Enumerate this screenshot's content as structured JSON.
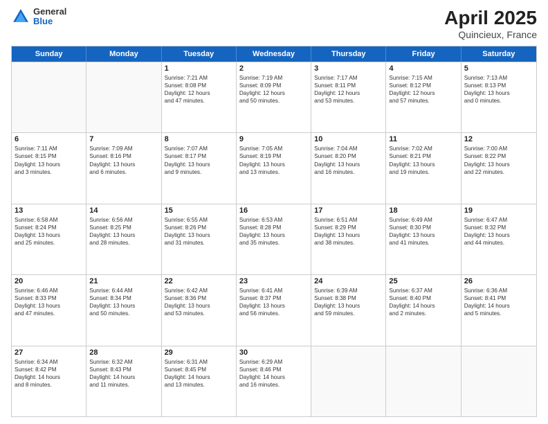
{
  "header": {
    "logo_general": "General",
    "logo_blue": "Blue",
    "month_year": "April 2025",
    "location": "Quincieux, France"
  },
  "calendar": {
    "weekdays": [
      "Sunday",
      "Monday",
      "Tuesday",
      "Wednesday",
      "Thursday",
      "Friday",
      "Saturday"
    ],
    "rows": [
      [
        {
          "day": "",
          "lines": [],
          "empty": true
        },
        {
          "day": "",
          "lines": [],
          "empty": true
        },
        {
          "day": "1",
          "lines": [
            "Sunrise: 7:21 AM",
            "Sunset: 8:08 PM",
            "Daylight: 12 hours",
            "and 47 minutes."
          ],
          "empty": false
        },
        {
          "day": "2",
          "lines": [
            "Sunrise: 7:19 AM",
            "Sunset: 8:09 PM",
            "Daylight: 12 hours",
            "and 50 minutes."
          ],
          "empty": false
        },
        {
          "day": "3",
          "lines": [
            "Sunrise: 7:17 AM",
            "Sunset: 8:11 PM",
            "Daylight: 12 hours",
            "and 53 minutes."
          ],
          "empty": false
        },
        {
          "day": "4",
          "lines": [
            "Sunrise: 7:15 AM",
            "Sunset: 8:12 PM",
            "Daylight: 12 hours",
            "and 57 minutes."
          ],
          "empty": false
        },
        {
          "day": "5",
          "lines": [
            "Sunrise: 7:13 AM",
            "Sunset: 8:13 PM",
            "Daylight: 13 hours",
            "and 0 minutes."
          ],
          "empty": false
        }
      ],
      [
        {
          "day": "6",
          "lines": [
            "Sunrise: 7:11 AM",
            "Sunset: 8:15 PM",
            "Daylight: 13 hours",
            "and 3 minutes."
          ],
          "empty": false
        },
        {
          "day": "7",
          "lines": [
            "Sunrise: 7:09 AM",
            "Sunset: 8:16 PM",
            "Daylight: 13 hours",
            "and 6 minutes."
          ],
          "empty": false
        },
        {
          "day": "8",
          "lines": [
            "Sunrise: 7:07 AM",
            "Sunset: 8:17 PM",
            "Daylight: 13 hours",
            "and 9 minutes."
          ],
          "empty": false
        },
        {
          "day": "9",
          "lines": [
            "Sunrise: 7:05 AM",
            "Sunset: 8:19 PM",
            "Daylight: 13 hours",
            "and 13 minutes."
          ],
          "empty": false
        },
        {
          "day": "10",
          "lines": [
            "Sunrise: 7:04 AM",
            "Sunset: 8:20 PM",
            "Daylight: 13 hours",
            "and 16 minutes."
          ],
          "empty": false
        },
        {
          "day": "11",
          "lines": [
            "Sunrise: 7:02 AM",
            "Sunset: 8:21 PM",
            "Daylight: 13 hours",
            "and 19 minutes."
          ],
          "empty": false
        },
        {
          "day": "12",
          "lines": [
            "Sunrise: 7:00 AM",
            "Sunset: 8:22 PM",
            "Daylight: 13 hours",
            "and 22 minutes."
          ],
          "empty": false
        }
      ],
      [
        {
          "day": "13",
          "lines": [
            "Sunrise: 6:58 AM",
            "Sunset: 8:24 PM",
            "Daylight: 13 hours",
            "and 25 minutes."
          ],
          "empty": false
        },
        {
          "day": "14",
          "lines": [
            "Sunrise: 6:56 AM",
            "Sunset: 8:25 PM",
            "Daylight: 13 hours",
            "and 28 minutes."
          ],
          "empty": false
        },
        {
          "day": "15",
          "lines": [
            "Sunrise: 6:55 AM",
            "Sunset: 8:26 PM",
            "Daylight: 13 hours",
            "and 31 minutes."
          ],
          "empty": false
        },
        {
          "day": "16",
          "lines": [
            "Sunrise: 6:53 AM",
            "Sunset: 8:28 PM",
            "Daylight: 13 hours",
            "and 35 minutes."
          ],
          "empty": false
        },
        {
          "day": "17",
          "lines": [
            "Sunrise: 6:51 AM",
            "Sunset: 8:29 PM",
            "Daylight: 13 hours",
            "and 38 minutes."
          ],
          "empty": false
        },
        {
          "day": "18",
          "lines": [
            "Sunrise: 6:49 AM",
            "Sunset: 8:30 PM",
            "Daylight: 13 hours",
            "and 41 minutes."
          ],
          "empty": false
        },
        {
          "day": "19",
          "lines": [
            "Sunrise: 6:47 AM",
            "Sunset: 8:32 PM",
            "Daylight: 13 hours",
            "and 44 minutes."
          ],
          "empty": false
        }
      ],
      [
        {
          "day": "20",
          "lines": [
            "Sunrise: 6:46 AM",
            "Sunset: 8:33 PM",
            "Daylight: 13 hours",
            "and 47 minutes."
          ],
          "empty": false
        },
        {
          "day": "21",
          "lines": [
            "Sunrise: 6:44 AM",
            "Sunset: 8:34 PM",
            "Daylight: 13 hours",
            "and 50 minutes."
          ],
          "empty": false
        },
        {
          "day": "22",
          "lines": [
            "Sunrise: 6:42 AM",
            "Sunset: 8:36 PM",
            "Daylight: 13 hours",
            "and 53 minutes."
          ],
          "empty": false
        },
        {
          "day": "23",
          "lines": [
            "Sunrise: 6:41 AM",
            "Sunset: 8:37 PM",
            "Daylight: 13 hours",
            "and 56 minutes."
          ],
          "empty": false
        },
        {
          "day": "24",
          "lines": [
            "Sunrise: 6:39 AM",
            "Sunset: 8:38 PM",
            "Daylight: 13 hours",
            "and 59 minutes."
          ],
          "empty": false
        },
        {
          "day": "25",
          "lines": [
            "Sunrise: 6:37 AM",
            "Sunset: 8:40 PM",
            "Daylight: 14 hours",
            "and 2 minutes."
          ],
          "empty": false
        },
        {
          "day": "26",
          "lines": [
            "Sunrise: 6:36 AM",
            "Sunset: 8:41 PM",
            "Daylight: 14 hours",
            "and 5 minutes."
          ],
          "empty": false
        }
      ],
      [
        {
          "day": "27",
          "lines": [
            "Sunrise: 6:34 AM",
            "Sunset: 8:42 PM",
            "Daylight: 14 hours",
            "and 8 minutes."
          ],
          "empty": false
        },
        {
          "day": "28",
          "lines": [
            "Sunrise: 6:32 AM",
            "Sunset: 8:43 PM",
            "Daylight: 14 hours",
            "and 11 minutes."
          ],
          "empty": false
        },
        {
          "day": "29",
          "lines": [
            "Sunrise: 6:31 AM",
            "Sunset: 8:45 PM",
            "Daylight: 14 hours",
            "and 13 minutes."
          ],
          "empty": false
        },
        {
          "day": "30",
          "lines": [
            "Sunrise: 6:29 AM",
            "Sunset: 8:46 PM",
            "Daylight: 14 hours",
            "and 16 minutes."
          ],
          "empty": false
        },
        {
          "day": "",
          "lines": [],
          "empty": true
        },
        {
          "day": "",
          "lines": [],
          "empty": true
        },
        {
          "day": "",
          "lines": [],
          "empty": true
        }
      ]
    ]
  }
}
